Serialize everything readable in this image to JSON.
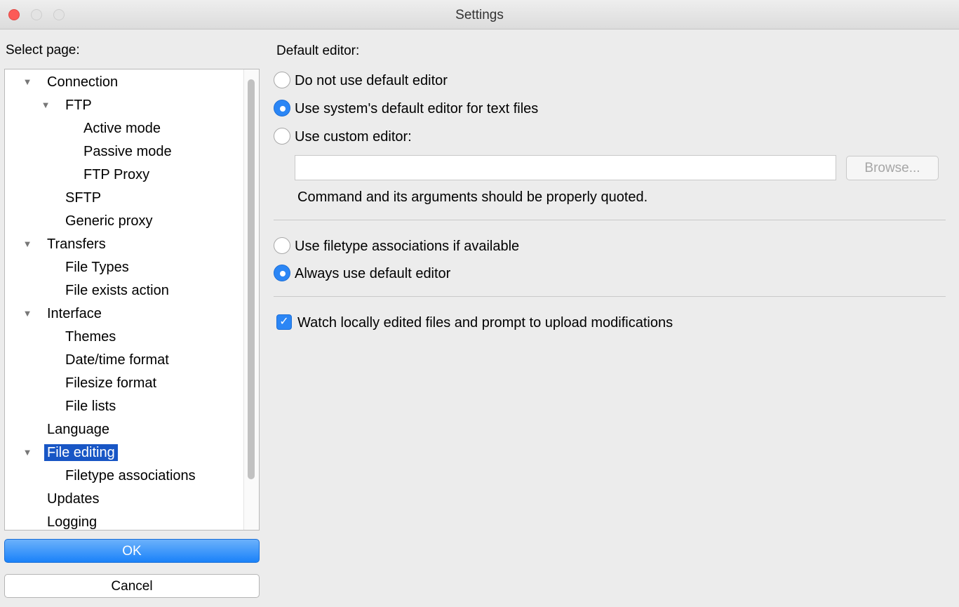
{
  "window": {
    "title": "Settings"
  },
  "sidebar": {
    "label": "Select page:",
    "items": [
      {
        "label": "Connection",
        "expanded": true
      },
      {
        "label": "FTP",
        "expanded": true
      },
      {
        "label": "Active mode"
      },
      {
        "label": "Passive mode"
      },
      {
        "label": "FTP Proxy"
      },
      {
        "label": "SFTP"
      },
      {
        "label": "Generic proxy"
      },
      {
        "label": "Transfers",
        "expanded": true
      },
      {
        "label": "File Types"
      },
      {
        "label": "File exists action"
      },
      {
        "label": "Interface",
        "expanded": true
      },
      {
        "label": "Themes"
      },
      {
        "label": "Date/time format"
      },
      {
        "label": "Filesize format"
      },
      {
        "label": "File lists"
      },
      {
        "label": "Language"
      },
      {
        "label": "File editing",
        "expanded": true,
        "selected": true
      },
      {
        "label": "Filetype associations"
      },
      {
        "label": "Updates"
      },
      {
        "label": "Logging"
      }
    ],
    "arrow_glyph": "▼"
  },
  "buttons": {
    "ok": "OK",
    "cancel": "Cancel"
  },
  "editor": {
    "section_title": "Default editor:",
    "options": [
      {
        "label": "Do not use default editor",
        "checked": false
      },
      {
        "label": "Use system's default editor for text files",
        "checked": true
      },
      {
        "label": "Use custom editor:",
        "checked": false
      }
    ],
    "custom_path": "",
    "browse_label": "Browse...",
    "note": "Command and its arguments should be properly quoted."
  },
  "association": {
    "options": [
      {
        "label": "Use filetype associations if available",
        "checked": false
      },
      {
        "label": "Always use default editor",
        "checked": true
      }
    ]
  },
  "watch": {
    "label": "Watch locally edited files and prompt to upload modifications",
    "checked": true,
    "check_glyph": "✓"
  },
  "colors": {
    "accent": "#2b86f5",
    "selection": "#1856c5",
    "close_light": "#fc5b57"
  }
}
